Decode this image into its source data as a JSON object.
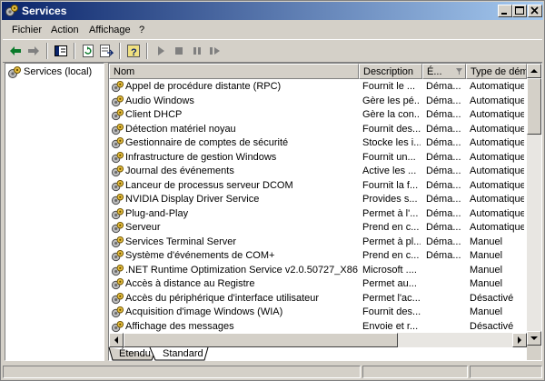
{
  "window": {
    "title": "Services",
    "app_icon": "services-gears-icon",
    "controls": [
      "minimize-icon",
      "maximize-icon",
      "close-icon"
    ]
  },
  "menu": {
    "items": [
      "Fichier",
      "Action",
      "Affichage",
      "?"
    ]
  },
  "toolbar": {
    "buttons": [
      "back-arrow-icon",
      "forward-arrow-icon",
      "show-hide-tree-icon",
      "refresh-icon",
      "export-list-icon",
      "help-icon",
      "start-service-icon",
      "stop-service-icon",
      "pause-service-icon",
      "restart-service-icon"
    ]
  },
  "tree": {
    "root_label": "Services (local)",
    "root_icon": "services-gears-icon"
  },
  "list": {
    "columns": [
      "Nom",
      "Description",
      "É...",
      "Type de démar"
    ],
    "rows": [
      {
        "name": "Appel de procédure distante (RPC)",
        "desc": "Fournit le ...",
        "state": "Déma...",
        "type": "Automatique"
      },
      {
        "name": "Audio Windows",
        "desc": "Gère les pé...",
        "state": "Déma...",
        "type": "Automatique"
      },
      {
        "name": "Client DHCP",
        "desc": "Gère la con...",
        "state": "Déma...",
        "type": "Automatique"
      },
      {
        "name": "Détection matériel noyau",
        "desc": "Fournit des...",
        "state": "Déma...",
        "type": "Automatique"
      },
      {
        "name": "Gestionnaire de comptes de sécurité",
        "desc": "Stocke les i...",
        "state": "Déma...",
        "type": "Automatique"
      },
      {
        "name": "Infrastructure de gestion Windows",
        "desc": "Fournit un...",
        "state": "Déma...",
        "type": "Automatique"
      },
      {
        "name": "Journal des événements",
        "desc": "Active les ...",
        "state": "Déma...",
        "type": "Automatique"
      },
      {
        "name": "Lanceur de processus serveur DCOM",
        "desc": "Fournit la f...",
        "state": "Déma...",
        "type": "Automatique"
      },
      {
        "name": "NVIDIA Display Driver Service",
        "desc": "Provides s...",
        "state": "Déma...",
        "type": "Automatique"
      },
      {
        "name": "Plug-and-Play",
        "desc": "Permet à l'...",
        "state": "Déma...",
        "type": "Automatique"
      },
      {
        "name": "Serveur",
        "desc": "Prend en c...",
        "state": "Déma...",
        "type": "Automatique"
      },
      {
        "name": "Services Terminal Server",
        "desc": "Permet à pl...",
        "state": "Déma...",
        "type": "Manuel"
      },
      {
        "name": "Système d'événements de COM+",
        "desc": "Prend en c...",
        "state": "Déma...",
        "type": "Manuel"
      },
      {
        "name": ".NET Runtime Optimization Service v2.0.50727_X86",
        "desc": "Microsoft ....",
        "state": "",
        "type": "Manuel"
      },
      {
        "name": "Accès à distance au Registre",
        "desc": "Permet au...",
        "state": "",
        "type": "Manuel"
      },
      {
        "name": "Accès du périphérique d'interface utilisateur",
        "desc": "Permet l'ac...",
        "state": "",
        "type": "Désactivé"
      },
      {
        "name": "Acquisition d'image Windows (WIA)",
        "desc": "Fournit des...",
        "state": "",
        "type": "Manuel"
      },
      {
        "name": "Affichage des messages",
        "desc": "Envoie et r...",
        "state": "",
        "type": "Désactivé"
      }
    ]
  },
  "tabs": [
    "Étendu",
    "Standard"
  ],
  "selected_tab": "Standard"
}
